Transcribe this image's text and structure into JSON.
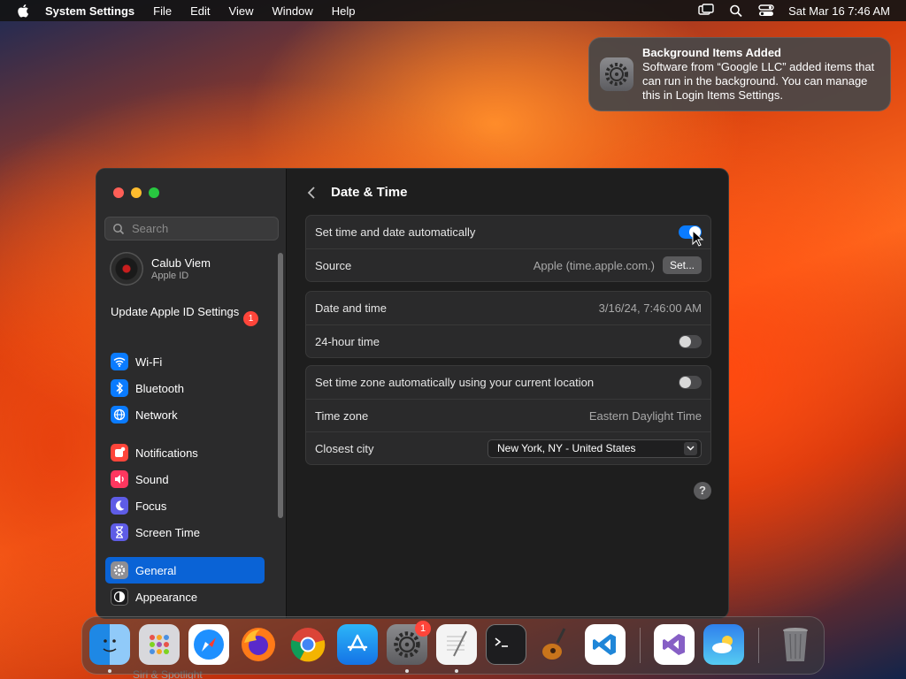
{
  "menubar": {
    "app_name": "System Settings",
    "menus": [
      "File",
      "Edit",
      "View",
      "Window",
      "Help"
    ],
    "clock": "Sat Mar 16  7:46 AM"
  },
  "notification": {
    "title": "Background Items Added",
    "body": "Software from “Google LLC” added items that can run in the background. You can manage this in Login Items Settings."
  },
  "sidebar": {
    "search_placeholder": "Search",
    "account": {
      "name": "Calub Viem",
      "subtitle": "Apple ID"
    },
    "update": {
      "label": "Update Apple ID Settings",
      "badge": "1"
    },
    "items": [
      {
        "label": "Wi-Fi",
        "icon": "wifi-icon",
        "color": "#0a7bff"
      },
      {
        "label": "Bluetooth",
        "icon": "bluetooth-icon",
        "color": "#0a7bff"
      },
      {
        "label": "Network",
        "icon": "network-icon",
        "color": "#0a7bff"
      },
      {
        "label": "Notifications",
        "icon": "notifications-icon",
        "color": "#ff453a"
      },
      {
        "label": "Sound",
        "icon": "sound-icon",
        "color": "#ff375f"
      },
      {
        "label": "Focus",
        "icon": "focus-icon",
        "color": "#5e5ce6"
      },
      {
        "label": "Screen Time",
        "icon": "screen-time-icon",
        "color": "#5e5ce6"
      },
      {
        "label": "General",
        "icon": "general-icon",
        "color": "#8e8e93",
        "active": true
      },
      {
        "label": "Appearance",
        "icon": "appearance-icon",
        "color": "#1c1c1e"
      }
    ],
    "partial_item": "Siri & Spotlight"
  },
  "main": {
    "title": "Date & Time",
    "group1": {
      "auto_label": "Set time and date automatically",
      "auto_on": true,
      "source_label": "Source",
      "source_value": "Apple (time.apple.com.)",
      "set_button": "Set..."
    },
    "group2": {
      "datetime_label": "Date and time",
      "datetime_value": "3/16/24, 7:46:00 AM",
      "hour24_label": "24-hour time",
      "hour24_on": false
    },
    "group3": {
      "tz_auto_label": "Set time zone automatically using your current location",
      "tz_auto_on": false,
      "tz_label": "Time zone",
      "tz_value": "Eastern Daylight Time",
      "city_label": "Closest city",
      "city_value": "New York, NY - United States"
    },
    "help": "?"
  },
  "dock": {
    "items": [
      "Finder",
      "Launchpad",
      "Safari",
      "Firefox",
      "Chrome",
      "App Store",
      "System Settings",
      "TextEdit",
      "Terminal",
      "GarageBand",
      "Visual Studio Code",
      "Visual Studio",
      "Weather",
      "Trash"
    ],
    "settings_badge": "1"
  }
}
